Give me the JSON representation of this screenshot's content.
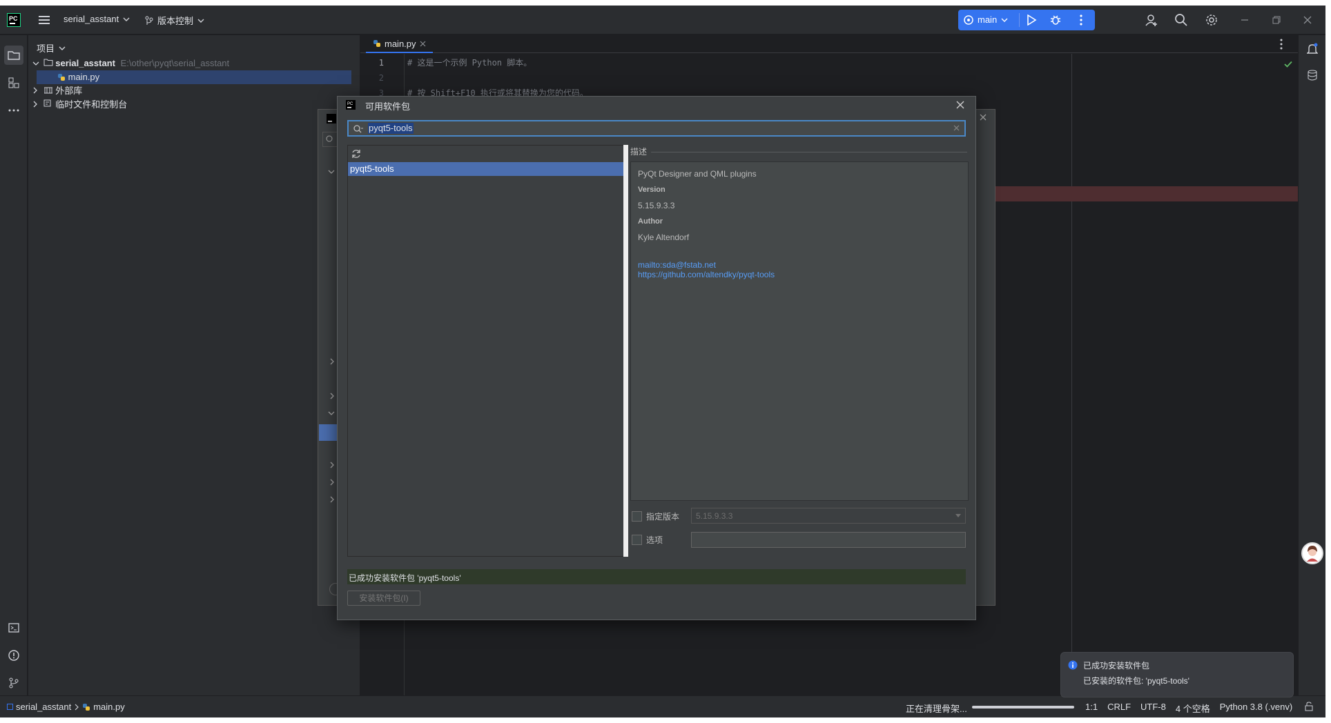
{
  "titlebar": {
    "project_name": "serial_asstant",
    "vcs_label": "版本控制",
    "branch": "main"
  },
  "project_panel": {
    "header": "项目",
    "tree": {
      "root_name": "serial_asstant",
      "root_path": "E:\\other\\pyqt\\serial_asstant",
      "file": "main.py",
      "external_libs": "外部库",
      "scratches": "临时文件和控制台"
    }
  },
  "editor": {
    "tab_label": "main.py",
    "lines": [
      {
        "num": "1",
        "code": "# 这是一个示例 Python 脚本。"
      },
      {
        "num": "2",
        "code": ""
      },
      {
        "num": "3",
        "code": "# 按 Shift+F10 执行或将其替换为您的代码。"
      }
    ]
  },
  "dialog": {
    "title": "可用软件包",
    "search_value": "pyqt5-tools",
    "packages": [
      "pyqt5-tools"
    ],
    "description_header": "描述",
    "description": {
      "summary": "PyQt Designer and QML plugins",
      "version_label": "Version",
      "version_value": "5.15.9.3.3",
      "author_label": "Author",
      "author_value": "Kyle Altendorf",
      "email_link": "mailto:sda@fstab.net",
      "repo_link": "https://github.com/altendky/pyqt-tools"
    },
    "specify_version_label": "指定版本",
    "specify_version_value": "5.15.9.3.3",
    "options_label": "选项",
    "options_value": "",
    "status_message": "已成功安装软件包 'pyqt5-tools'",
    "install_button": "安装软件包(I)"
  },
  "notification": {
    "title": "已成功安装软件包",
    "body": "已安装的软件包: 'pyqt5-tools'"
  },
  "statusbar": {
    "breadcrumb_project": "serial_asstant",
    "breadcrumb_file": "main.py",
    "task": "正在清理骨架...",
    "task_progress": 1.0,
    "position": "1:1",
    "line_sep": "CRLF",
    "encoding": "UTF-8",
    "indent": "4 个空格",
    "interpreter": "Python 3.8 (.venv)"
  },
  "colors": {
    "accent": "#3574f0",
    "selection": "#4b6eaf",
    "success_bg": "#2f3a2a",
    "link": "#589df6"
  }
}
